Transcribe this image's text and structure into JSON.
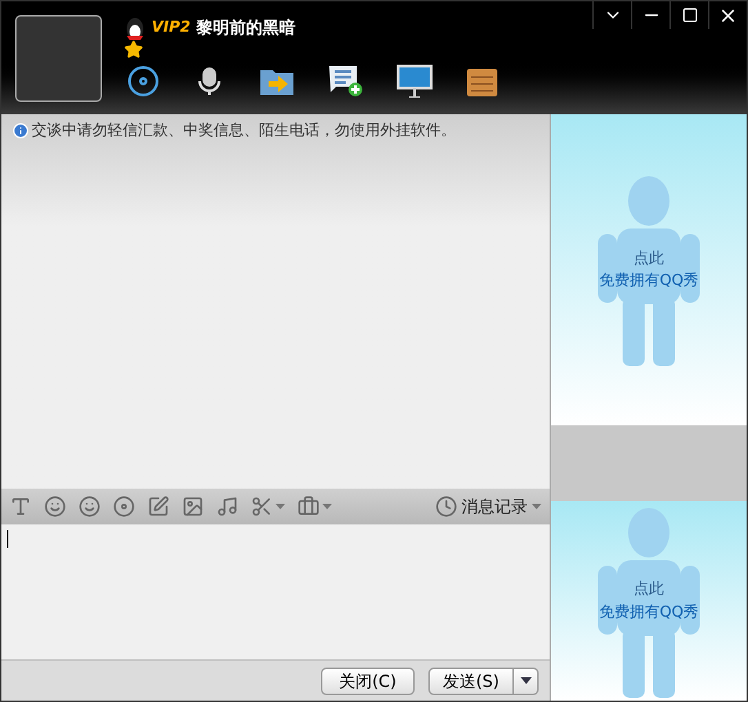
{
  "contact": {
    "vip": "VIP2",
    "name": "黎明前的黑暗"
  },
  "notice": "交谈中请勿轻信汇款、中奖信息、陌生电话，勿使用外挂软件。",
  "history_button": "消息记录",
  "buttons": {
    "close": "关闭(C)",
    "send": "发送(S)"
  },
  "qq_show": [
    {
      "prompt": "点此",
      "link": "免费拥有QQ秀"
    },
    {
      "prompt": "点此",
      "link": "免费拥有QQ秀"
    }
  ]
}
